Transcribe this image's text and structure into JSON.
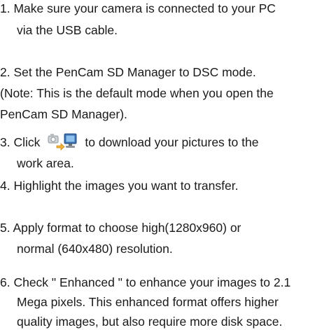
{
  "steps": [
    {
      "lines": [
        "1. Make sure your camera is connected to your PC",
        "via the USB cable."
      ]
    },
    {
      "lines": [
        "2. Set the PenCam SD Manager to DSC mode.",
        "(Note: This is the default mode when you open the",
        "PenCam SD Manager)."
      ]
    },
    {
      "before_icon": "3. Click",
      "after_icon": "to download your pictures to the",
      "icon": "download-to-pc-icon",
      "lines": [
        "work area."
      ]
    },
    {
      "lines": [
        "4. Highlight the images you want to transfer."
      ]
    },
    {
      "lines": [
        "5. Apply format to choose high(1280x960) or",
        "normal (640x480) resolution."
      ]
    },
    {
      "lines": [
        "6. Check \" Enhanced \" to enhance your images to 2.1",
        "Mega pixels. This enhanced format offers higher",
        "quality images, but also require more disk space."
      ]
    }
  ],
  "colors": {
    "text": "#1a1a1a",
    "icon_monitor": "#3a6fb0",
    "icon_camera": "#9aa0a6"
  }
}
